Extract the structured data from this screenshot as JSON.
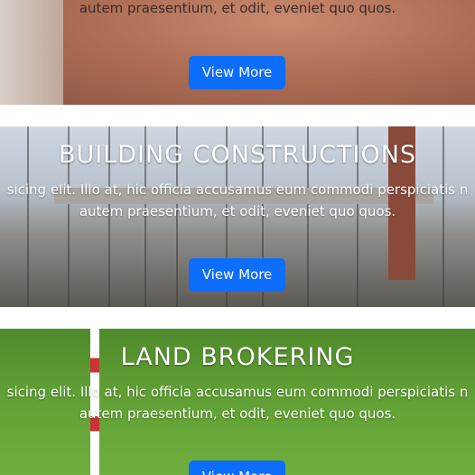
{
  "sections": [
    {
      "title": "",
      "line1": "",
      "line2": "autem praesentium, et odit, eveniet quo quos.",
      "button": "View More"
    },
    {
      "title": "BUILDING CONSTRUCTIONS",
      "line1": "sicing elit. Illo at, hic officia accusamus eum commodi perspiciatis n",
      "line2": "autem praesentium, et odit, eveniet quo quos.",
      "button": "View More"
    },
    {
      "title": "LAND BROKERING",
      "line1": "sicing elit. Illo at, hic officia accusamus eum commodi perspiciatis n",
      "line2": "autem praesentium, et odit, eveniet quo quos.",
      "button": "View More"
    }
  ],
  "colors": {
    "button": "#0d6efd",
    "text": "#ffffff"
  }
}
